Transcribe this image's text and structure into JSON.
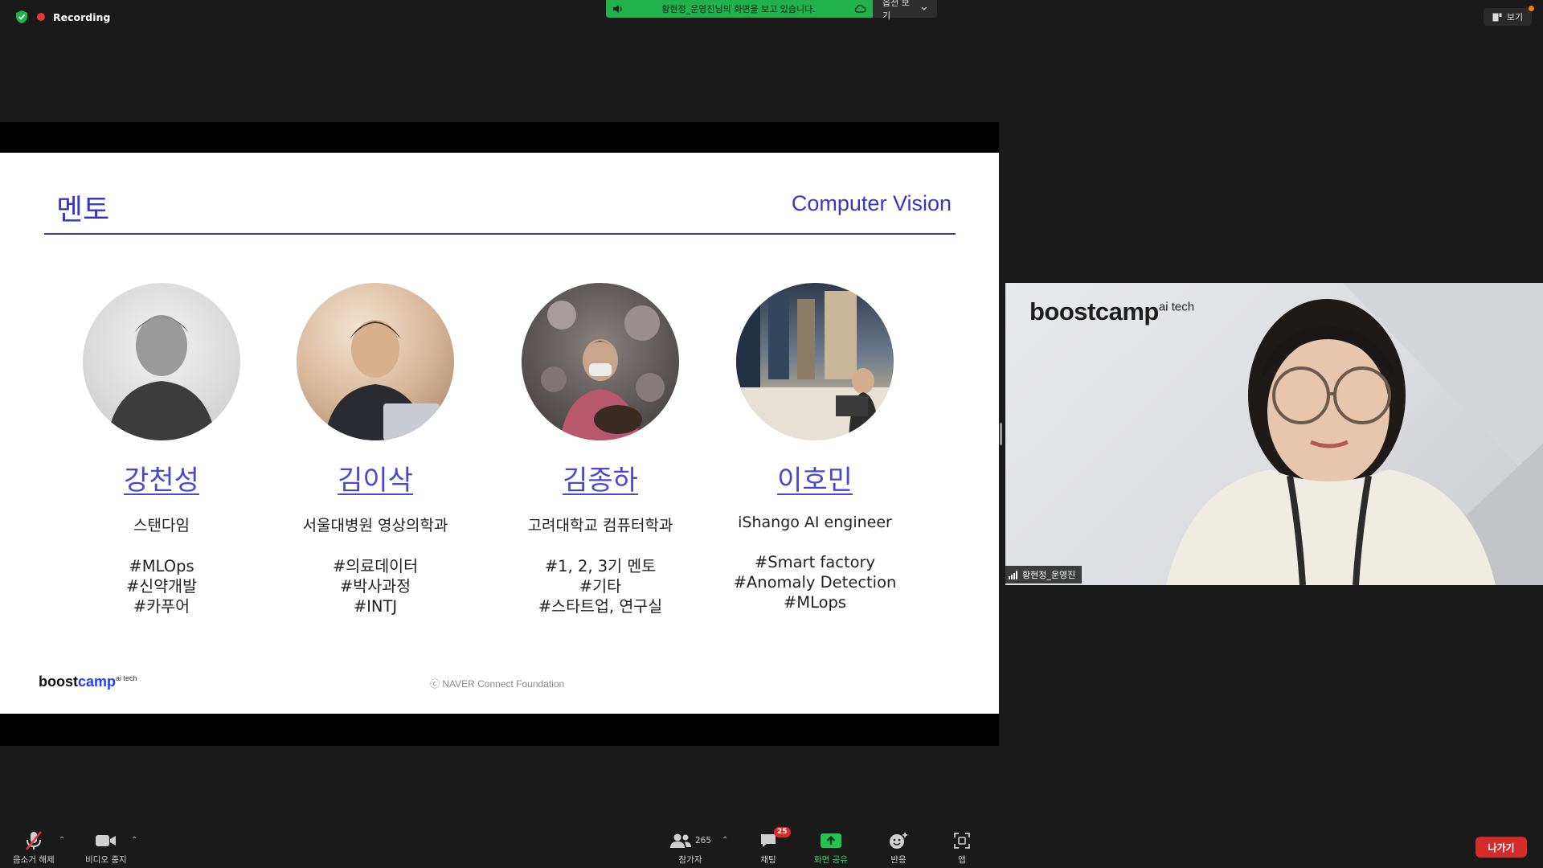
{
  "recording": {
    "label": "Recording"
  },
  "share_banner": {
    "message": "황현정_운영진님의 화면을 보고 있습니다.",
    "options_label": "옵션 보기"
  },
  "view_button": {
    "label": "보기"
  },
  "slide": {
    "title": "멘토",
    "subtitle": "Computer Vision",
    "mentors": [
      {
        "name": "강천성",
        "org": "스탠다임",
        "tags": [
          "#MLOps",
          "#신약개발",
          "#카푸어"
        ]
      },
      {
        "name": "김이삭",
        "org": "서울대병원 영상의학과",
        "tags": [
          "#의료데이터",
          "#박사과정",
          "#INTJ"
        ]
      },
      {
        "name": "김종하",
        "org": "고려대학교 컴퓨터학과",
        "tags": [
          "#1, 2, 3기 멘토",
          "#기타",
          "#스타트업, 연구실"
        ]
      },
      {
        "name": "이호민",
        "org": "iShango AI engineer",
        "tags": [
          "#Smart factory",
          "#Anomaly Detection",
          "#MLops"
        ]
      }
    ],
    "logo": {
      "boost": "boost",
      "camp": "camp",
      "sup": "ai tech"
    },
    "footer": "ⓒ  NAVER Connect Foundation"
  },
  "video": {
    "logo": {
      "text": "boostcamp",
      "sup": "ai tech"
    },
    "participant_name": "황현정_운영진"
  },
  "toolbar": {
    "mute_label": "음소거 해제",
    "video_label": "비디오 중지",
    "participants_label": "참가자",
    "participants_count": "265",
    "chat_label": "채팅",
    "chat_badge": "25",
    "share_label": "화면 공유",
    "reactions_label": "반응",
    "apps_label": "앱",
    "leave_label": "나가기"
  },
  "colors": {
    "accent": "#3a36c4",
    "share_green": "#23b14d",
    "leave_red": "#d42b2b"
  }
}
